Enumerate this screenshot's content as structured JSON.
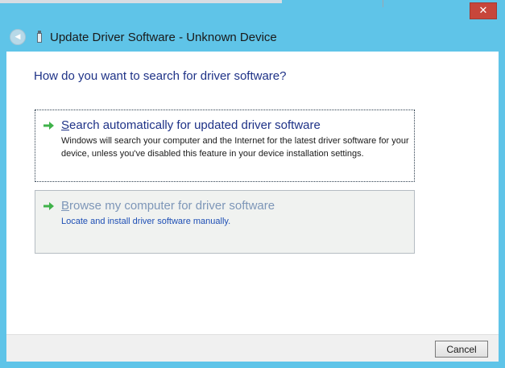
{
  "window": {
    "title": "Update Driver Software - Unknown Device",
    "close_symbol": "✕",
    "back_symbol": "◀"
  },
  "heading": "How do you want to search for driver software?",
  "options": [
    {
      "title_mnemonic": "S",
      "title_rest": "earch automatically for updated driver software",
      "description": "Windows will search your computer and the Internet for the latest driver software for your device, unless you've disabled this feature in your device installation settings.",
      "icon": "green-arrow-icon"
    },
    {
      "title_mnemonic": "B",
      "title_rest": "rowse my computer for driver software",
      "description": "Locate and install driver software manually.",
      "icon": "green-arrow-icon"
    }
  ],
  "footer": {
    "cancel_label": "Cancel"
  },
  "colors": {
    "frame": "#5fc4e8",
    "heading": "#1e3287",
    "arrow": "#3fb24a",
    "close": "#c7463b"
  }
}
